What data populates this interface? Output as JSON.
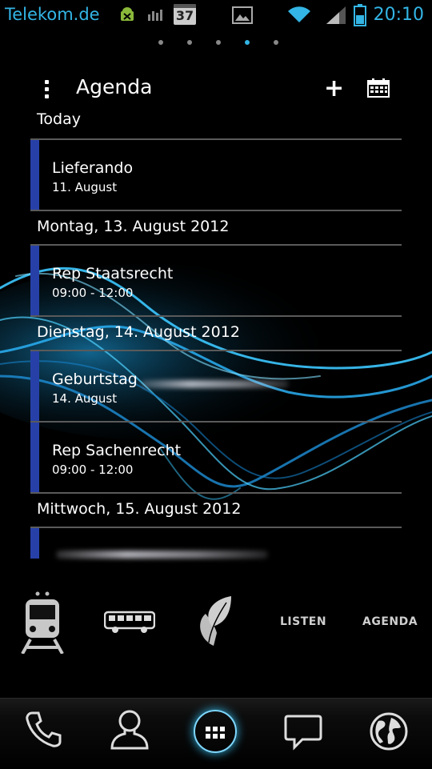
{
  "status_bar": {
    "carrier": "Telekom.de",
    "notification_count": "37",
    "time": "20:10",
    "battery_level": 0.5,
    "accent_color": "#33b5e5",
    "icons": [
      "android-debug-icon",
      "signal-graph-icon",
      "calendar-notification-icon",
      "image-icon",
      "wifi-icon",
      "cell-signal-icon",
      "battery-icon"
    ]
  },
  "page_indicator": {
    "count": 5,
    "active_index": 3
  },
  "agenda": {
    "title": "Agenda",
    "sections": [
      {
        "header": "Today",
        "events": [
          {
            "title": "Lieferando",
            "subtitle": "11. August"
          }
        ]
      },
      {
        "header": "Montag, 13. August 2012",
        "events": [
          {
            "title": "Rep Staatsrecht",
            "subtitle": "09:00 - 12:00"
          }
        ]
      },
      {
        "header": "Dienstag, 14. August 2012",
        "events": [
          {
            "title": "Geburtstag",
            "subtitle": "14. August"
          },
          {
            "title": "Rep Sachenrecht",
            "subtitle": "09:00 - 12:00"
          }
        ]
      },
      {
        "header": "Mittwoch, 15. August 2012",
        "events": [
          {
            "title": "",
            "subtitle": ""
          }
        ]
      }
    ],
    "event_color": "#2740a8"
  },
  "shortcuts": {
    "items": [
      "train-icon",
      "bus-icon",
      "leaf-icon"
    ],
    "listen_label": "LISTEN",
    "agenda_label": "AGENDA"
  },
  "dock": {
    "items": [
      "phone-icon",
      "contacts-icon",
      "app-drawer-icon",
      "messaging-icon",
      "browser-globe-icon"
    ]
  }
}
